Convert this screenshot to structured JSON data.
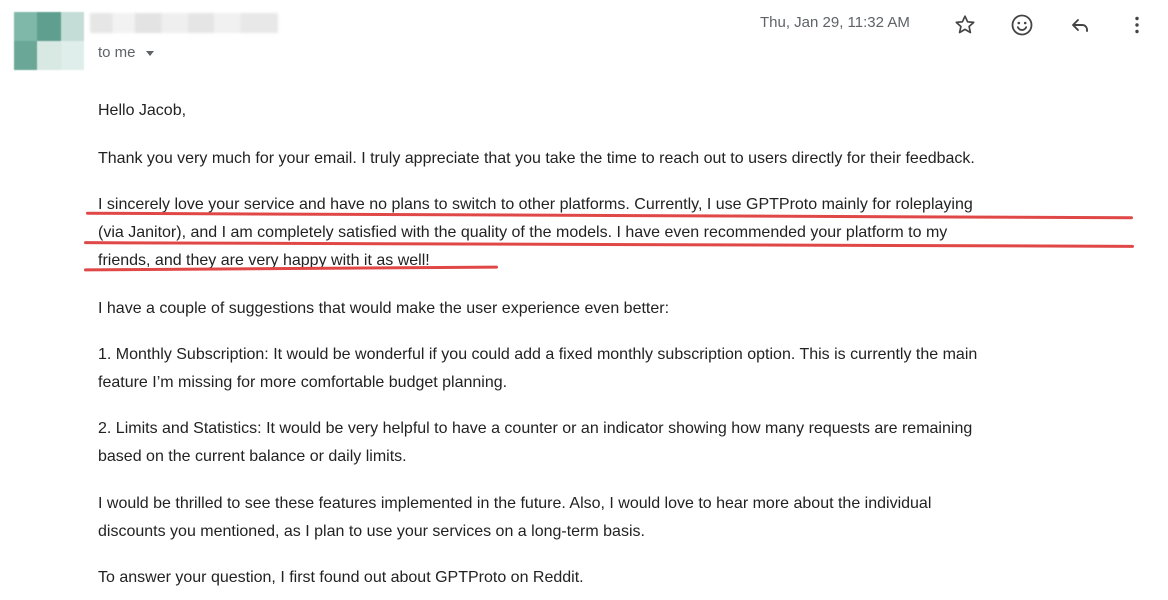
{
  "header": {
    "recipient_label": "to me",
    "timestamp": "Thu, Jan 29, 11:32 AM",
    "icons": [
      "star-icon",
      "emoji-icon",
      "reply-icon",
      "more-vert-icon"
    ]
  },
  "email": {
    "greeting": "Hello Jacob,",
    "p1": "Thank you very much for your email. I truly appreciate that you take the time to reach out to users directly for their feedback.",
    "p2_lines": [
      "I sincerely love your service and have no plans to switch to other platforms. Currently, I use GPTProto mainly for roleplaying",
      "(via Janitor), and I am completely satisfied with the quality of the models. I have even recommended your platform to my",
      "friends, and they are very happy with it as well!"
    ],
    "p3": "I have a couple of suggestions that would make the user experience even better:",
    "p4_lines": [
      "1. Monthly Subscription: It would be wonderful if you could add a fixed monthly subscription option. This is currently the main",
      "feature I’m missing for more comfortable budget planning."
    ],
    "p5_lines": [
      "2. Limits and Statistics: It would be very helpful to have a counter or an indicator showing how many requests are remaining",
      "based on the current balance or daily limits."
    ],
    "p6_lines": [
      "I would be thrilled to see these features implemented in the future. Also, I would love to hear more about the individual",
      "discounts you mentioned, as I plan to use your services on a long-term basis."
    ],
    "p7": "To answer your question, I first found out about GPTProto on Reddit."
  },
  "colors": {
    "annotation_underline": "#e04848",
    "secondary_text": "#5f6368"
  }
}
